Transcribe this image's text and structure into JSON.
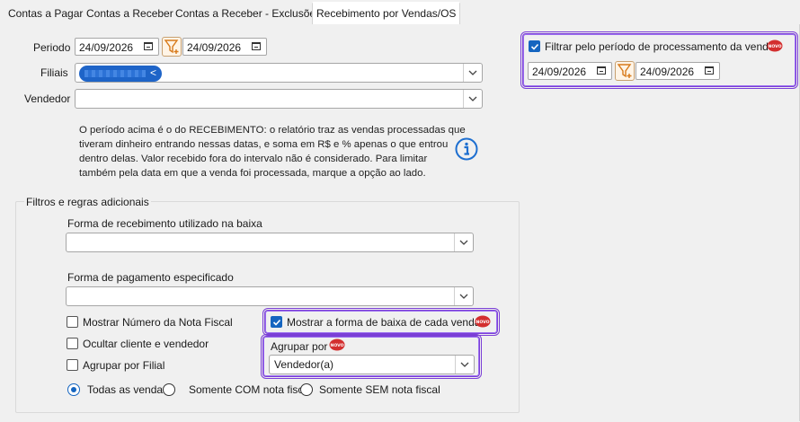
{
  "tabs": [
    {
      "label": "Contas a Pagar",
      "active": false
    },
    {
      "label": "Contas a Receber",
      "active": false
    },
    {
      "label": "Contas a Receber - Exclusões",
      "active": false
    },
    {
      "label": "Recebimento por Vendas/OS",
      "active": true
    }
  ],
  "periodo": {
    "label": "Periodo",
    "start": "24/09/2026",
    "end": "24/09/2026"
  },
  "filiais": {
    "label": "Filiais",
    "chip_remove": "<"
  },
  "vendedor": {
    "label": "Vendedor",
    "value": ""
  },
  "info_text": "O período acima é o do RECEBIMENTO: o relatório traz as vendas processadas que tiveram dinheiro entrando nessas datas, e soma em R$ e % apenas o que entrou dentro delas. Valor recebido fora do intervalo não é considerado. Para limitar também pela data em que a venda foi processada, marque a opção ao lado.",
  "processamento": {
    "checkbox_label": "Filtrar pelo período de processamento da venda",
    "checked": true,
    "start": "24/09/2026",
    "end": "24/09/2026"
  },
  "filtros": {
    "title": "Filtros e regras adicionais",
    "forma_recebimento": {
      "label": "Forma de recebimento utilizado na baixa",
      "value": ""
    },
    "forma_pagamento": {
      "label": "Forma de pagamento especificado",
      "value": ""
    },
    "checkboxes": [
      {
        "label": "Mostrar Número da Nota Fiscal",
        "checked": false
      },
      {
        "label": "Ocultar cliente e vendedor",
        "checked": false
      },
      {
        "label": "Agrupar por Filial",
        "checked": false
      }
    ],
    "mostrar_baixa": {
      "label": "Mostrar a forma de baixa de cada venda",
      "checked": true
    },
    "agrupar_por": {
      "label": "Agrupar por",
      "value": "Vendedor(a)"
    },
    "radios": [
      {
        "label": "Todas as vendas",
        "checked": true
      },
      {
        "label": "Somente COM nota fiscal",
        "checked": false
      },
      {
        "label": "Somente SEM nota fiscal",
        "checked": false
      }
    ]
  },
  "badge_text": "NOVO",
  "colors": {
    "accent": "#1565c0",
    "highlight": "#7b3fd6",
    "badge": "#d32f2f"
  }
}
